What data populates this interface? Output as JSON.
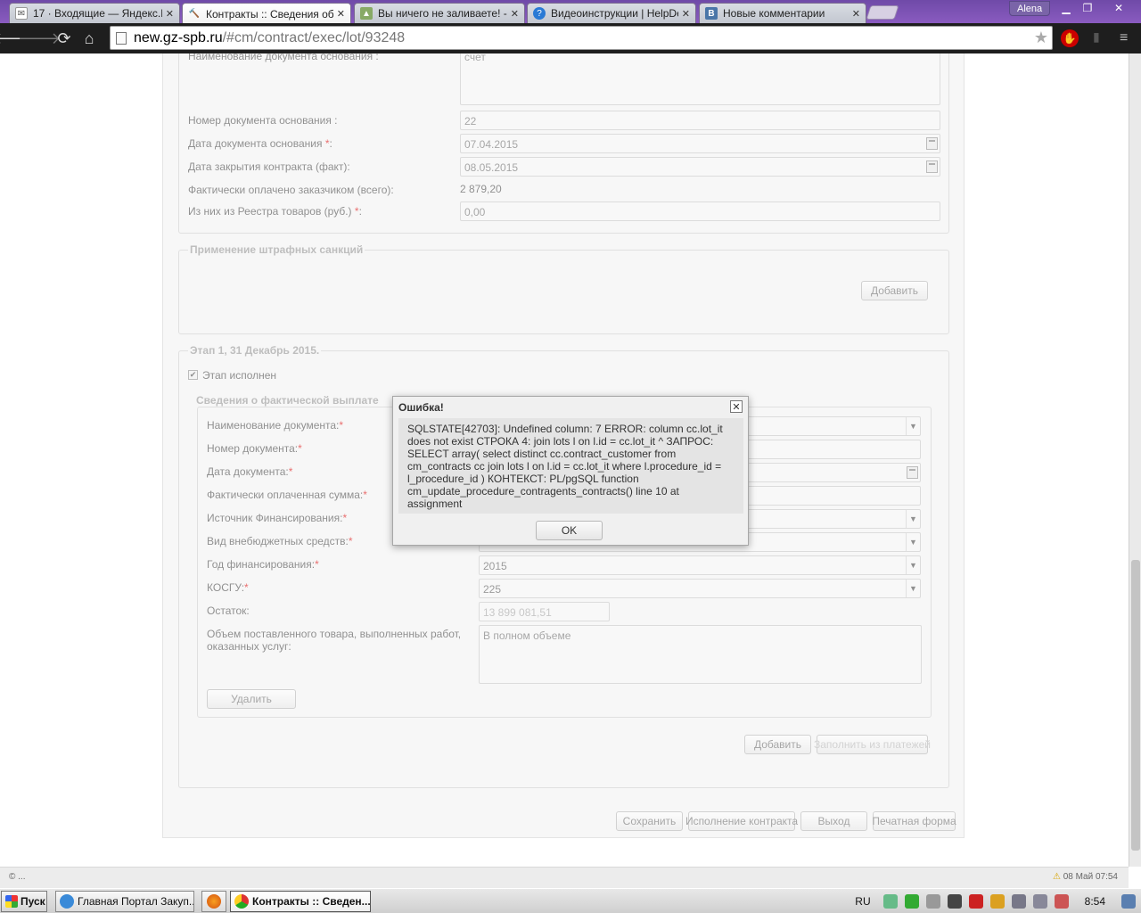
{
  "browser": {
    "tabs": [
      {
        "title": "17 · Входящие — Яндекс.П",
        "icon": "mail-icon",
        "active": false
      },
      {
        "title": "Контракты :: Сведения об",
        "icon": "gavel-icon",
        "active": true
      },
      {
        "title": "Вы ничего не заливаете! -",
        "icon": "image-icon",
        "active": false
      },
      {
        "title": "Видеоинструкции | HelpDe",
        "icon": "help-icon",
        "active": false
      },
      {
        "title": "Новые комментарии",
        "icon": "vk-icon",
        "active": false
      }
    ],
    "user": "Alena",
    "url_host": "new.gz-spb.ru",
    "url_path": "/#cm/contract/exec/lot/93248"
  },
  "contract": {
    "doc_basis_name_label": "Наименование документа основания :",
    "doc_basis_name_value": "счет",
    "doc_basis_number_label": "Номер документа основания :",
    "doc_basis_number_value": "22",
    "doc_basis_date_label": "Дата документа основания",
    "doc_basis_date_value": "07.04.2015",
    "close_date_label": "Дата закрытия контракта (факт):",
    "close_date_value": "08.05.2015",
    "paid_total_label": "Фактически оплачено заказчиком (всего):",
    "paid_total_value": "2 879,20",
    "registry_label": "Из них из Реестра товаров (руб.)",
    "registry_value": "0,00"
  },
  "penalties": {
    "legend": "Применение штрафных санкций",
    "add_label": "Добавить"
  },
  "stage": {
    "legend": "Этап 1, 31 Декабрь 2015.",
    "done_label": "Этап исполнен",
    "done_checked": true,
    "payment": {
      "legend": "Сведения о фактической выплате",
      "doc_name_label": "Наименование документа:",
      "doc_number_label": "Номер документа:",
      "doc_date_label": "Дата документа:",
      "paid_sum_label": "Фактически оплаченная сумма:",
      "source_label": "Источник Финансирования:",
      "budget_type_label": "Вид внебюджетных средств:",
      "year_label": "Год финансирования:",
      "year_value": "2015",
      "kosgu_label": "КОСГУ:",
      "kosgu_value": "225",
      "remainder_label": "Остаток:",
      "remainder_value": "13 899 081,51",
      "volume_label": "Объем поставленного товара, выполненных работ, оказанных услуг:",
      "volume_value": "В полном объеме",
      "delete_label": "Удалить"
    },
    "add_label": "Добавить",
    "fill_label": "Заполнить из платежей"
  },
  "footer_buttons": {
    "save": "Сохранить",
    "execution": "Исполнение контракта",
    "exit": "Выход",
    "print": "Печатная форма"
  },
  "dialog": {
    "title": "Ошибка!",
    "message": "SQLSTATE[42703]: Undefined column: 7 ERROR: column cc.lot_it does not exist СТРОКА 4: join lots l on l.id = cc.lot_it ^ ЗАПРОС: SELECT array( select distinct cc.contract_customer from cm_contracts cc join lots l on l.id = cc.lot_it where l.procedure_id = l_procedure_id ) КОНТЕКСТ: PL/pgSQL function cm_update_procedure_contragents_contracts() line 10 at assignment",
    "ok": "OK"
  },
  "statusbar": {
    "left": "© ...",
    "right": "08 Май 07:54"
  },
  "taskbar": {
    "start": "Пуск",
    "items": [
      "Главная Портал Закуп...",
      "Контракты :: Сведен..."
    ],
    "lang": "RU",
    "clock": "8:54"
  },
  "required_mark": "*",
  "colors": {
    "tabbar": "#7a52b5",
    "toolbar": "#1e1e1e",
    "required": "#dd2222"
  }
}
